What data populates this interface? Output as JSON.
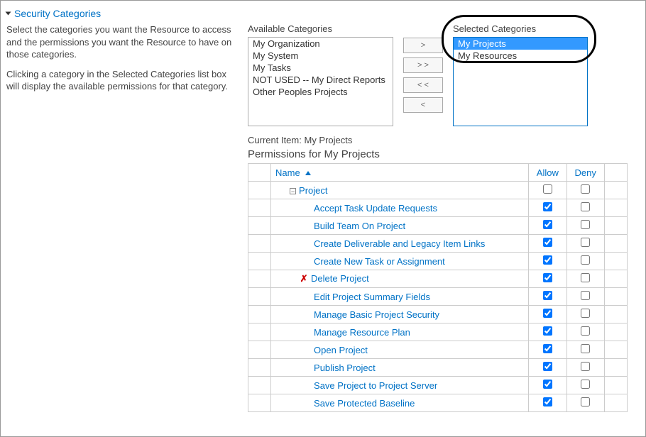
{
  "section_title": "Security Categories",
  "description_1": "Select the categories you want the Resource to access and the permissions you want the Resource to have on those categories.",
  "description_2": "Clicking a category in the Selected Categories list box will display the available permissions for that category.",
  "available_label": "Available Categories",
  "selected_label": "Selected Categories",
  "available_items": [
    "My Organization",
    "My System",
    "My Tasks",
    "NOT USED -- My Direct Reports",
    "Other Peoples Projects"
  ],
  "selected_items": [
    {
      "text": "My Projects",
      "selected": true
    },
    {
      "text": "My Resources",
      "selected": false
    }
  ],
  "move_buttons": {
    "add": ">",
    "add_all": "> >",
    "remove_all": "< <",
    "remove": "<"
  },
  "current_item_label": "Current Item:",
  "current_item_value": "My Projects",
  "permissions_title": "Permissions for My Projects",
  "columns": {
    "name": "Name",
    "allow": "Allow",
    "deny": "Deny"
  },
  "group_row": {
    "label": "Project",
    "allow": false,
    "deny": false
  },
  "permissions": [
    {
      "name": "Accept Task Update Requests",
      "allow": true,
      "deny": false,
      "icon": ""
    },
    {
      "name": "Build Team On Project",
      "allow": true,
      "deny": false,
      "icon": ""
    },
    {
      "name": "Create Deliverable and Legacy Item Links",
      "allow": true,
      "deny": false,
      "icon": ""
    },
    {
      "name": "Create New Task or Assignment",
      "allow": true,
      "deny": false,
      "icon": ""
    },
    {
      "name": "Delete Project",
      "allow": true,
      "deny": false,
      "icon": "x"
    },
    {
      "name": "Edit Project Summary Fields",
      "allow": true,
      "deny": false,
      "icon": ""
    },
    {
      "name": "Manage Basic Project Security",
      "allow": true,
      "deny": false,
      "icon": ""
    },
    {
      "name": "Manage Resource Plan",
      "allow": true,
      "deny": false,
      "icon": ""
    },
    {
      "name": "Open Project",
      "allow": true,
      "deny": false,
      "icon": ""
    },
    {
      "name": "Publish Project",
      "allow": true,
      "deny": false,
      "icon": ""
    },
    {
      "name": "Save Project to Project Server",
      "allow": true,
      "deny": false,
      "icon": ""
    },
    {
      "name": "Save Protected Baseline",
      "allow": true,
      "deny": false,
      "icon": ""
    }
  ]
}
